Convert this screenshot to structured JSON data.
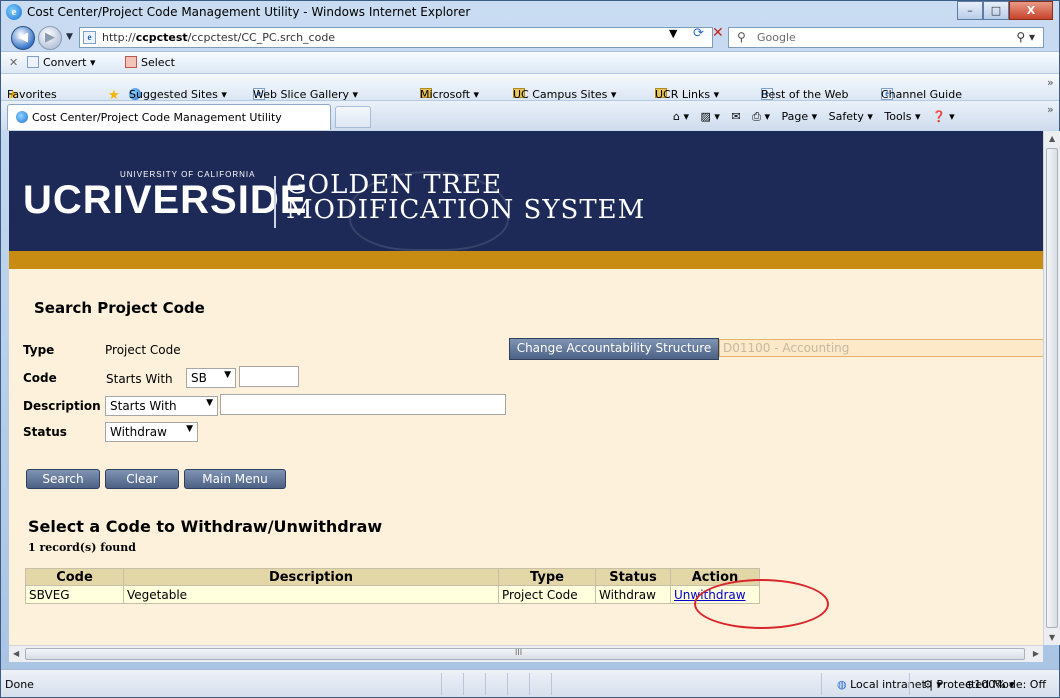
{
  "window": {
    "title": "Cost Center/Project Code Management Utility - Windows Internet Explorer",
    "minimize": "–",
    "maximize": "□",
    "close": "X"
  },
  "address": {
    "url_prefix": "http://",
    "url_host": "ccpctest",
    "url_path": "/ccpctest/CC_PC.srch_code",
    "search_placeholder": "Google"
  },
  "command_bar": {
    "convert": "Convert",
    "select": "Select"
  },
  "favorites_bar": {
    "favorites": "Favorites",
    "items": [
      "Suggested Sites ▾",
      "Web Slice Gallery ▾",
      "Microsoft ▾",
      "UC Campus Sites ▾",
      "UCR Links ▾",
      "Best of the Web",
      "Channel Guide"
    ]
  },
  "tab": {
    "label": "Cost Center/Project Code Management Utility",
    "tools": [
      "Page ▾",
      "Safety ▾",
      "Tools ▾"
    ]
  },
  "banner": {
    "logo": "UCRIVERSIDE",
    "logo_small": "UNIVERSITY OF CALIFORNIA",
    "system_line1": "Golden Tree",
    "system_line2": "Modification System"
  },
  "search": {
    "heading": "Search Project Code",
    "type_label": "Type",
    "type_value": "Project Code",
    "code_label": "Code",
    "code_starts": "Starts With",
    "code_select": "SB",
    "desc_label": "Description",
    "desc_select": "Starts With",
    "status_label": "Status",
    "status_select": "Withdraw",
    "change_btn": "Change Accountability Structure",
    "acct_value": "D01100 - Accounting",
    "btn_search": "Search",
    "btn_clear": "Clear",
    "btn_menu": "Main Menu"
  },
  "results": {
    "heading": "Select a Code to Withdraw/Unwithdraw",
    "count": "1 record(s) found",
    "columns": [
      "Code",
      "Description",
      "Type",
      "Status",
      "Action"
    ],
    "rows": [
      {
        "code": "SBVEG",
        "description": "Vegetable",
        "type": "Project Code",
        "status": "Withdraw",
        "action": "Unwithdraw"
      }
    ]
  },
  "statusbar": {
    "left": "Done",
    "zone": "Local intranet | Protected Mode: Off",
    "zoom": "100%"
  },
  "colors": {
    "banner": "#1d2a57",
    "goldbar": "#c98c12",
    "content_bg": "#fdf1dc",
    "highlight_circle": "#d8262b"
  }
}
